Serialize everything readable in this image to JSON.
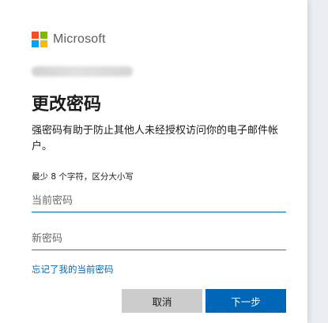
{
  "brand": {
    "name": "Microsoft",
    "logo_colors": [
      "#f25022",
      "#7fba00",
      "#00a4ef",
      "#ffb900"
    ]
  },
  "page": {
    "title": "更改密码",
    "description": "强密码有助于防止其他人未经授权访问你的电子邮件帐户。",
    "requirement_hint": "最少 8 个字符，区分大小写"
  },
  "form": {
    "current_password": {
      "placeholder": "当前密码",
      "value": ""
    },
    "new_password": {
      "placeholder": "新密码",
      "value": ""
    },
    "forgot_link": "忘记了我的当前密码"
  },
  "actions": {
    "cancel_label": "取消",
    "next_label": "下一步"
  },
  "colors": {
    "accent": "#0067b8",
    "cancel_bg": "#cccccc"
  }
}
